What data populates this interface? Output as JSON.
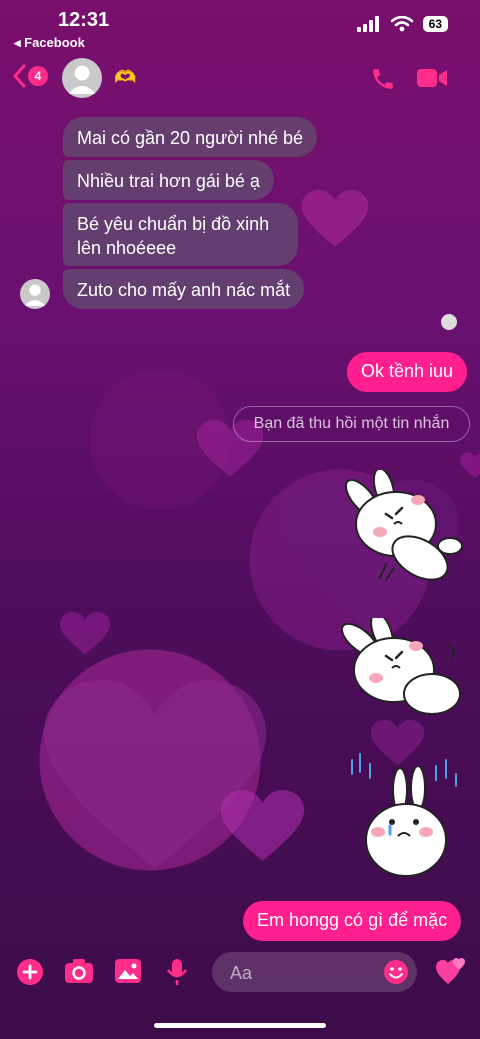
{
  "status_bar": {
    "time": "12:31",
    "back_app": "◂ Facebook",
    "battery": "63"
  },
  "header": {
    "back_badge": "4",
    "contact_emoji": "🫶"
  },
  "messages": {
    "incoming": [
      "Mai có gần 20 người nhé bé",
      "Nhiều trai hơn gái bé ạ",
      "Bé yêu chuẩn bị đồ xinh lên nhoéeee",
      "Zuto cho mấy anh nác mắt"
    ],
    "outgoing_1": "Ok tềnh iuu",
    "recalled": "Bạn đã thu hồi một tin nhắn",
    "outgoing_2": "Em hongg có gì để mặc"
  },
  "composer": {
    "placeholder": "Aa"
  },
  "colors": {
    "accent": "#ff1f8e",
    "icon_pink": "#ff2d8a",
    "incoming_bubble": "#5f506e"
  }
}
